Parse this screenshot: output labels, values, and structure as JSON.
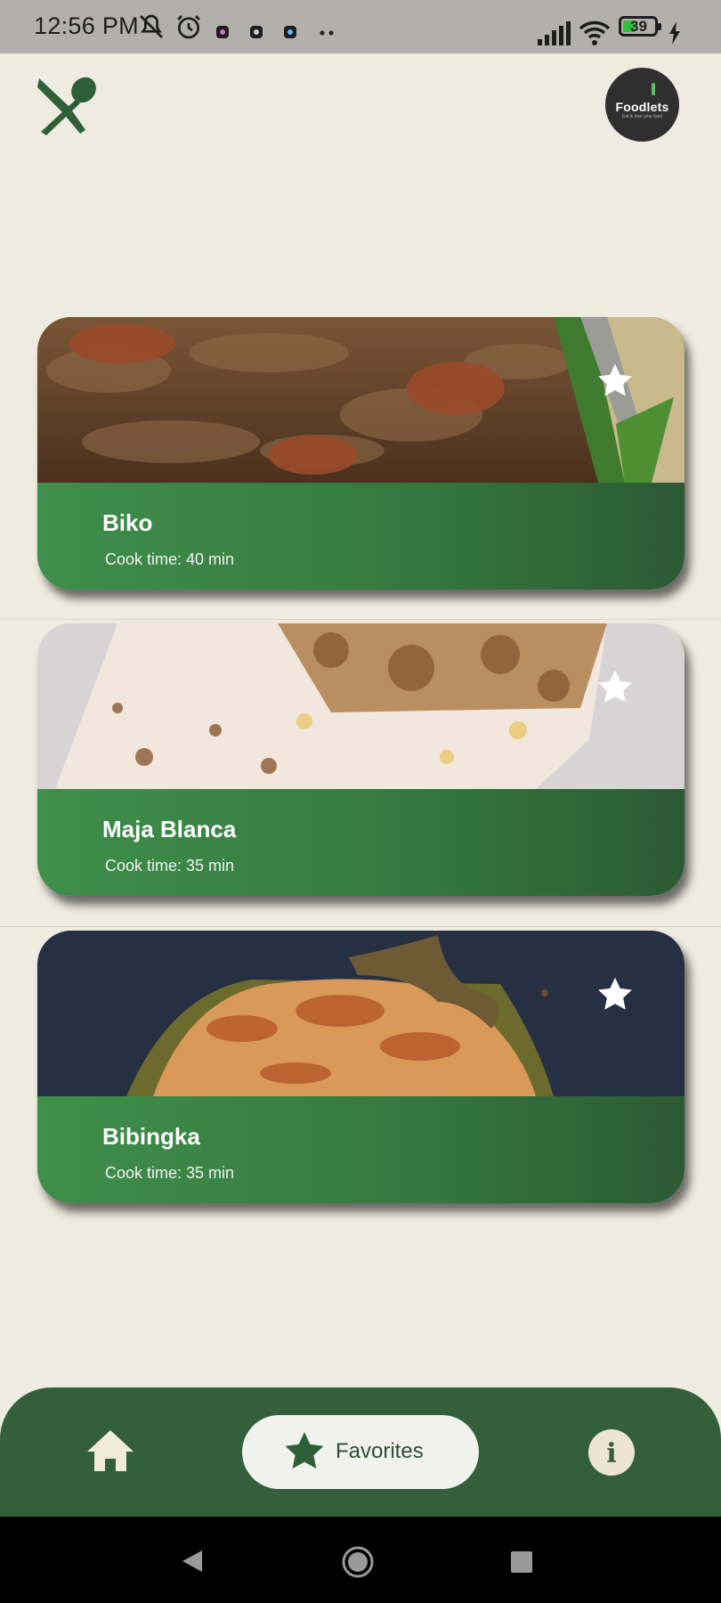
{
  "status_bar": {
    "time": "12:56 PM",
    "battery_level": "39",
    "icons": [
      "mute-icon",
      "alarm-icon",
      "app-notification-icon",
      "app-notification-icon",
      "app-notification-icon",
      "more-dots-icon",
      "signal-icon",
      "wifi-icon",
      "battery-icon",
      "charging-icon"
    ]
  },
  "header": {
    "app_icon": "spoon-knife-icon",
    "brand": {
      "name": "Foodlets",
      "tagline": "Eat & love your food"
    }
  },
  "recipes": [
    {
      "name": "Biko",
      "cook_time": "Cook time: 40 min",
      "favorite_icon": "star-icon"
    },
    {
      "name": "Maja Blanca",
      "cook_time": "Cook time: 35 min",
      "favorite_icon": "star-icon"
    },
    {
      "name": "Bibingka",
      "cook_time": "Cook time: 35 min",
      "favorite_icon": "star-icon"
    }
  ],
  "bottom_nav": {
    "home_icon": "home-icon",
    "favorites_label": "Favorites",
    "favorites_icon": "star-icon",
    "info_icon": "info-icon",
    "info_glyph": "i"
  },
  "colors": {
    "background": "#eeebe0",
    "primary_green": "#335f3a",
    "card_band": "#3f8f4a",
    "status_bar": "#b2b0aa"
  }
}
